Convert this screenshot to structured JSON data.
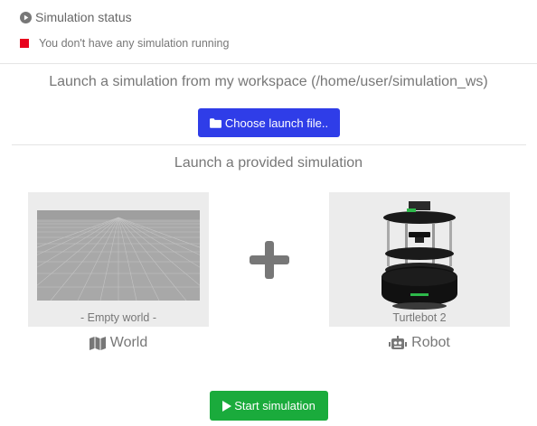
{
  "status": {
    "title": "Simulation status",
    "title_icon": "play-circle-icon",
    "message": "You don't have any simulation running",
    "indicator_color": "#e8001c"
  },
  "workspace": {
    "heading": "Launch a simulation from my workspace (/home/user/simulation_ws)",
    "choose_button_label": "Choose launch file..",
    "choose_button_icon": "folder-icon",
    "accent_color": "#2f3de8"
  },
  "provided": {
    "heading": "Launch a provided simulation",
    "world": {
      "caption": "- Empty world -",
      "label": "World",
      "icon": "map-icon"
    },
    "combine_icon": "plus-icon",
    "robot": {
      "caption": "Turtlebot 2",
      "label": "Robot",
      "icon": "robot-icon"
    }
  },
  "start_button": {
    "label": "Start simulation",
    "icon": "play-icon",
    "color": "#1aab3c"
  }
}
